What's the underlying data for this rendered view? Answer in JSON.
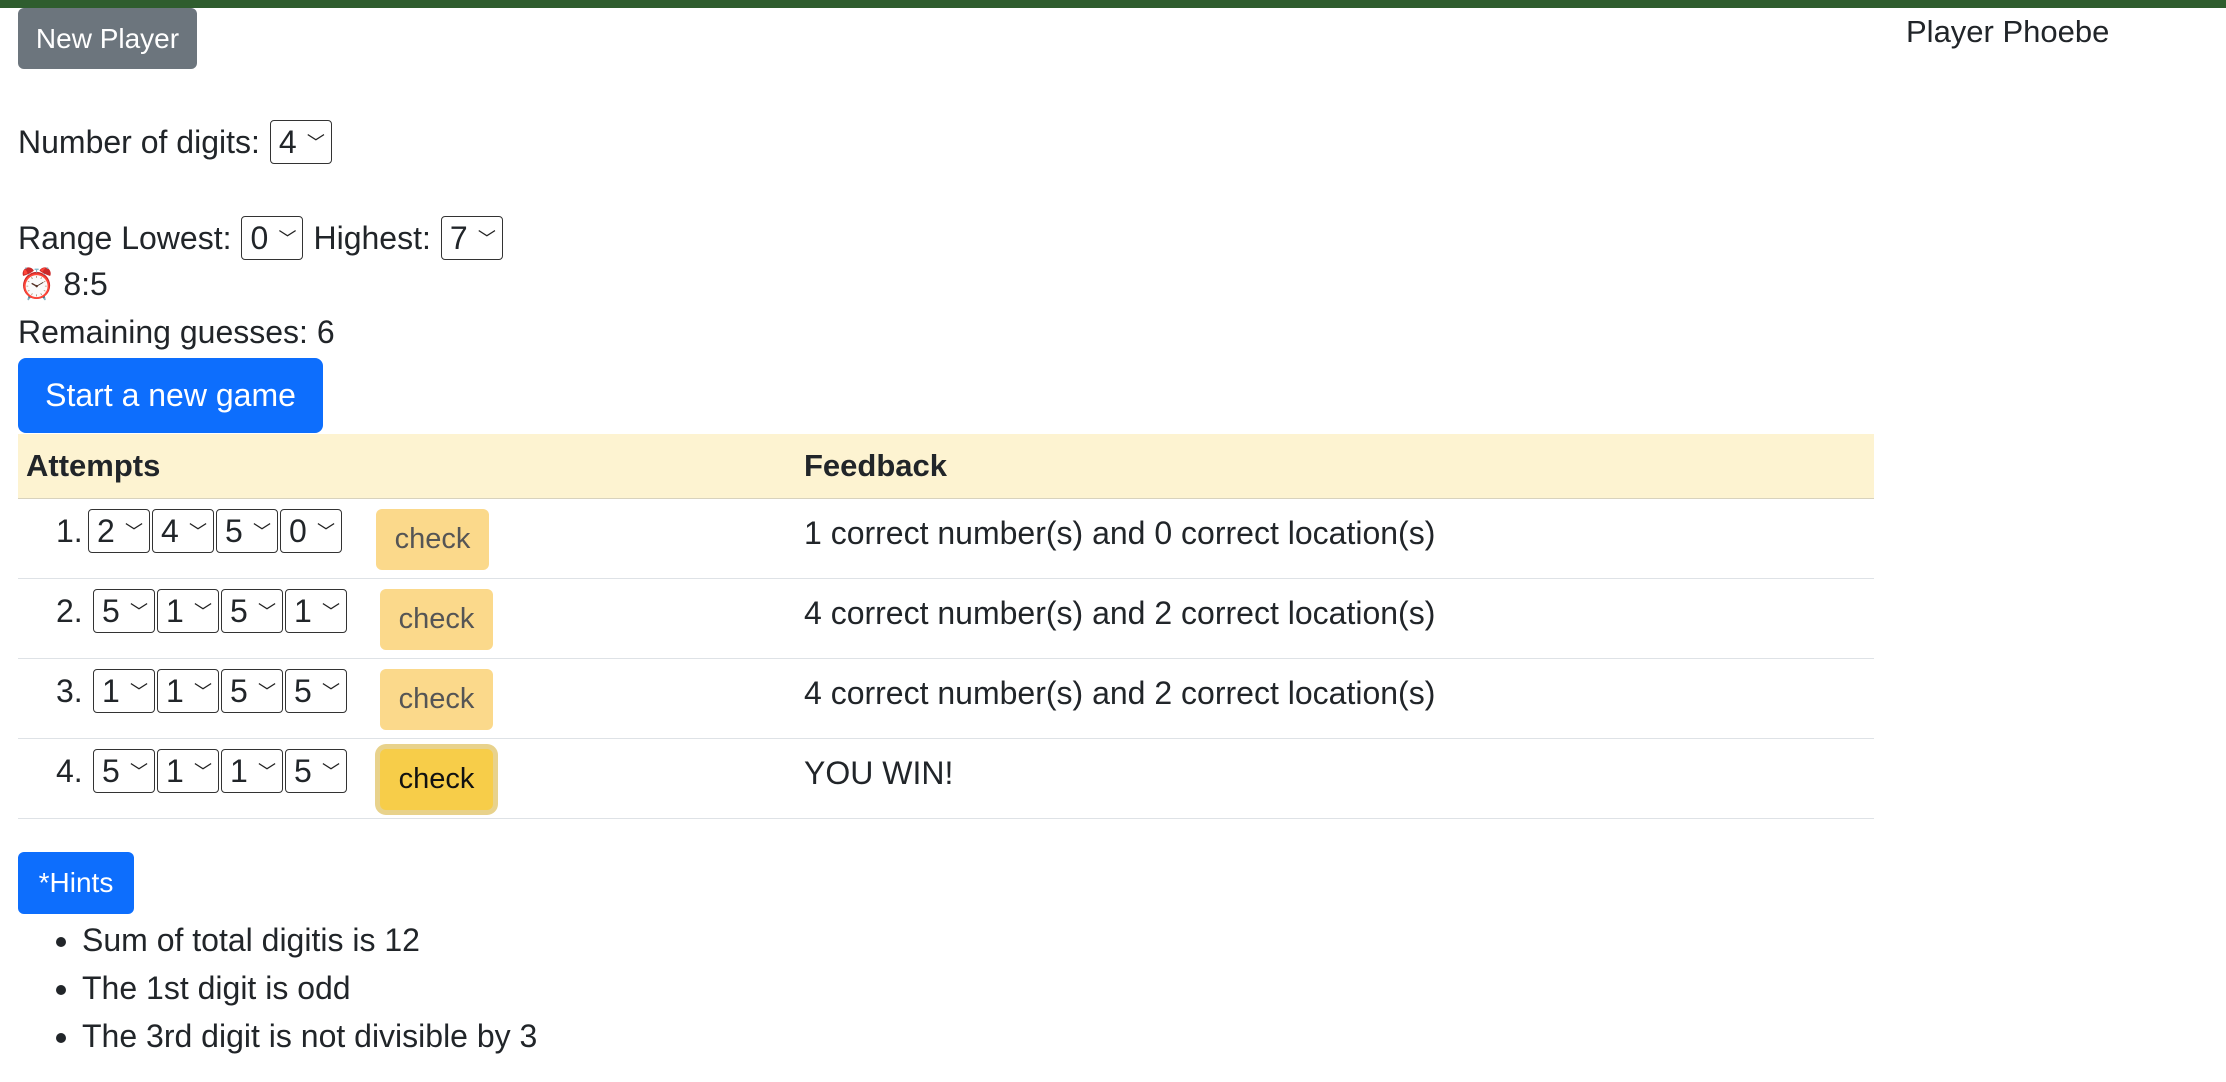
{
  "header": {
    "new_player_label": "New Player",
    "player_name": "Player Phoebe"
  },
  "settings": {
    "digits_label": "Number of digits:",
    "digits_value": "4",
    "range_lowest_label": "Range Lowest:",
    "range_lowest_value": "0",
    "range_highest_label": "Highest:",
    "range_highest_value": "7"
  },
  "timer": {
    "icon": "alarm-clock-icon",
    "emoji": "⏰",
    "value": "8:5"
  },
  "remaining": {
    "text": "Remaining guesses: 6"
  },
  "start_button": "Start a new game",
  "table": {
    "headers": [
      "Attempts",
      "Feedback"
    ],
    "rows": [
      {
        "num": "1.",
        "digits": [
          "2",
          "4",
          "5",
          "0"
        ],
        "check": "check",
        "feedback": "1 correct number(s) and 0 correct location(s)"
      },
      {
        "num": "2.",
        "digits": [
          "5",
          "1",
          "5",
          "1"
        ],
        "check": "check",
        "feedback": "4 correct number(s) and 2 correct location(s)"
      },
      {
        "num": "3.",
        "digits": [
          "1",
          "1",
          "5",
          "5"
        ],
        "check": "check",
        "feedback": "4 correct number(s) and 2 correct location(s)"
      },
      {
        "num": "4.",
        "digits": [
          "5",
          "1",
          "1",
          "5"
        ],
        "check": "check",
        "feedback": "YOU WIN!"
      }
    ]
  },
  "hints": {
    "button_label": "*Hints",
    "items": [
      "Sum of total digitis is 12",
      "The 1st digit is odd",
      "The 3rd digit is not divisible by 3"
    ]
  },
  "colors": {
    "primary": "#0d6efd",
    "secondary": "#6c757d",
    "warning": "#f7cd49",
    "header_bg": "#fdf3d1",
    "topbar": "#2f5d2e"
  }
}
